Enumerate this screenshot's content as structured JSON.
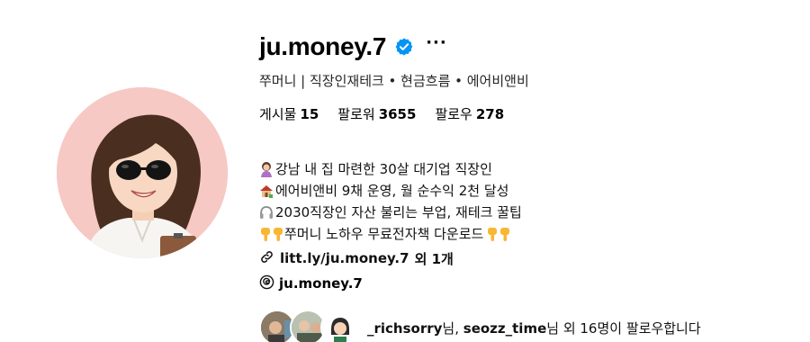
{
  "profile": {
    "username": "ju.money.7",
    "more_label": "···",
    "full_name": "쭈머니 | 직장인재테크 • 현금흐름 • 에어비앤비",
    "stats": [
      {
        "label": "게시물",
        "value": "15"
      },
      {
        "label": "팔로워",
        "value": "3655"
      },
      {
        "label": "팔로우",
        "value": "278"
      }
    ],
    "bio": [
      {
        "icon": "woman-emoji",
        "text": "강남 내 집 마련한 30살 대기업 직장인"
      },
      {
        "icon": "house-emoji",
        "text": "에어비앤비 9채 운영, 월 순수익 2천 달성"
      },
      {
        "icon": "headphones-emoji",
        "text": "2030직장인 자산 불리는 부업, 재테크 꿀팁"
      },
      {
        "icon": "pointing-down-emoji",
        "text": "쭈머니 노하우 무료전자책 다운로드"
      }
    ],
    "link": {
      "text": "litt.ly/ju.money.7",
      "suffix": "외 1개"
    },
    "threads_handle": "ju.money.7",
    "followed_by": {
      "user1": "_richsorry",
      "sep1": "님, ",
      "user2": "seozz_time",
      "rest": "님 외 16명이 팔로우합니다"
    }
  },
  "colors": {
    "verified": "#0095f6",
    "avatar_bg": "#f5c7c3"
  }
}
